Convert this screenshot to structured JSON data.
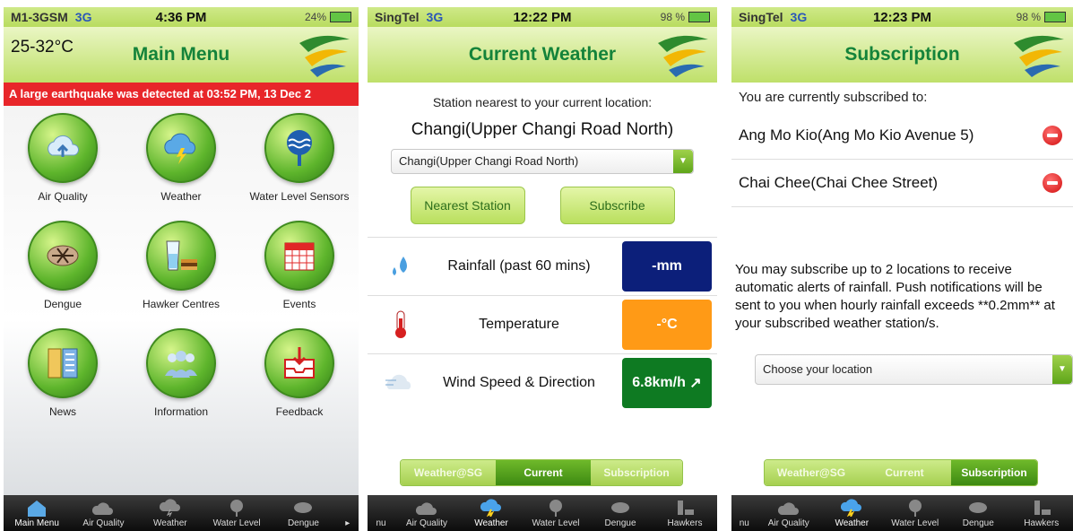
{
  "screen1": {
    "status": {
      "carrier": "M1-3GSM",
      "network": "3G",
      "time": "4:36 PM",
      "battery": "24%"
    },
    "temperature": "25-32°C",
    "title": "Main Menu",
    "alert": "A large earthquake was detected at 03:52 PM, 13 Dec 2",
    "menu": [
      {
        "label": "Air Quality",
        "icon": "cloud-upload-icon"
      },
      {
        "label": "Weather",
        "icon": "storm-cloud-icon"
      },
      {
        "label": "Water Level Sensors",
        "icon": "water-sensor-icon"
      },
      {
        "label": "Dengue",
        "icon": "mosquito-icon"
      },
      {
        "label": "Hawker Centres",
        "icon": "food-drink-icon"
      },
      {
        "label": "Events",
        "icon": "calendar-icon"
      },
      {
        "label": "News",
        "icon": "newspaper-icon"
      },
      {
        "label": "Information",
        "icon": "people-icon"
      },
      {
        "label": "Feedback",
        "icon": "inbox-icon"
      }
    ],
    "tabs": [
      "Main Menu",
      "Air Quality",
      "Weather",
      "Water Level",
      "Dengue"
    ]
  },
  "screen2": {
    "status": {
      "carrier": "SingTel",
      "network": "3G",
      "time": "12:22 PM",
      "battery": "98 %"
    },
    "title": "Current Weather",
    "intro": "Station nearest to your current location:",
    "station": "Changi(Upper Changi Road North)",
    "select_value": "Changi(Upper Changi Road North)",
    "buttons": {
      "nearest": "Nearest Station",
      "subscribe": "Subscribe"
    },
    "rows": [
      {
        "label": "Rainfall (past 60 mins)",
        "value": "-mm",
        "color": "#0c1f7a",
        "icon": "raindrop-icon"
      },
      {
        "label": "Temperature",
        "value": "-°C",
        "color": "#ff9a16",
        "icon": "thermometer-icon"
      },
      {
        "label": "Wind Speed & Direction",
        "value": "6.8km/h",
        "color": "#0e7a22",
        "icon": "wind-cloud-icon"
      }
    ],
    "segments": [
      "Weather@SG",
      "Current",
      "Subscription"
    ],
    "tabs": [
      "nu",
      "Air Quality",
      "Weather",
      "Water Level",
      "Dengue",
      "Hawkers"
    ]
  },
  "screen3": {
    "status": {
      "carrier": "SingTel",
      "network": "3G",
      "time": "12:23 PM",
      "battery": "98 %"
    },
    "title": "Subscription",
    "heading": "You are currently subscribed to:",
    "subscriptions": [
      "Ang Mo Kio(Ang Mo Kio Avenue 5)",
      "Chai Chee(Chai Chee Street)"
    ],
    "info": "You may subscribe up to 2 locations to receive automatic alerts of rainfall. Push notifications will be sent to you when hourly rainfall exceeds **0.2mm** at your subscribed weather station/s.",
    "select_placeholder": "Choose your location",
    "segments": [
      "Weather@SG",
      "Current",
      "Subscription"
    ],
    "tabs": [
      "nu",
      "Air Quality",
      "Weather",
      "Water Level",
      "Dengue",
      "Hawkers"
    ]
  }
}
